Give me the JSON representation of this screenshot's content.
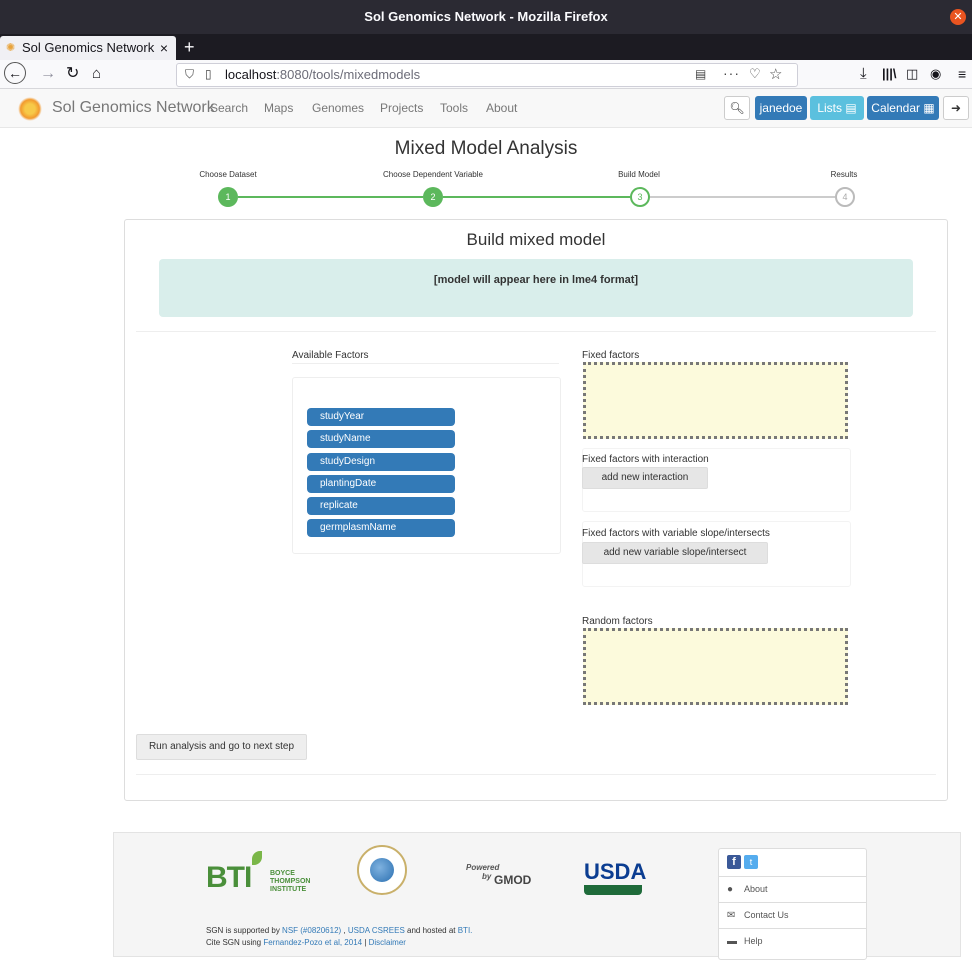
{
  "window": {
    "title": "Sol Genomics Network - Mozilla Firefox"
  },
  "tab": {
    "title": "Sol Genomics Network",
    "close_glyph": "×",
    "new_tab_glyph": "+"
  },
  "address_bar": {
    "host": "localhost",
    "rest": ":8080/tools/mixedmodels"
  },
  "site": {
    "brand": "Sol Genomics Network",
    "menu": [
      "Search",
      "Maps",
      "Genomes",
      "Projects",
      "Tools",
      "About"
    ],
    "user": "janedoe",
    "lists": "Lists",
    "calendar": "Calendar",
    "colors": {
      "primary": "#337ab7",
      "info": "#5bc0de",
      "success": "#5cb85c"
    }
  },
  "page": {
    "title": "Mixed Model Analysis",
    "steps": [
      {
        "label": "Choose Dataset",
        "number": "1"
      },
      {
        "label": "Choose Dependent Variable",
        "number": "2"
      },
      {
        "label": "Build Model",
        "number": "3"
      },
      {
        "label": "Results",
        "number": "4"
      }
    ],
    "panel_title": "Build mixed model",
    "model_placeholder": "[model will appear here in lme4 format]",
    "available_factors_label": "Available Factors",
    "factors": [
      "studyYear",
      "studyName",
      "studyDesign",
      "plantingDate",
      "replicate",
      "germplasmName"
    ],
    "fixed_factors_label": "Fixed factors",
    "fixed_interaction_label": "Fixed factors with interaction",
    "add_interaction_button": "add new interaction",
    "fixed_slope_label": "Fixed factors with variable slope/intersects",
    "add_slope_button": "add new variable slope/intersect",
    "random_factors_label": "Random factors",
    "run_button": "Run analysis and go to next step"
  },
  "footer": {
    "bti": {
      "letters": "BTI",
      "line1": "BOYCE",
      "line2": "THOMPSON",
      "line3": "INSTITUTE"
    },
    "gmod": {
      "powered": "Powered",
      "by": "by",
      "name": "GMOD"
    },
    "usda": "USDA",
    "support_prefix": "SGN is supported by ",
    "nsf": "NSF (#0820612)",
    "support_mid": " , ",
    "csrees": "USDA CSREES",
    "support_suffix": "  and hosted at ",
    "bti_link": "BTI.",
    "cite_prefix": "Cite SGN using ",
    "cite_link": "Fernandez-Pozo et al, 2014",
    "cite_sep": "  |  ",
    "disclaimer": "Disclaimer",
    "links": [
      "About",
      "Contact Us",
      "Help"
    ]
  }
}
